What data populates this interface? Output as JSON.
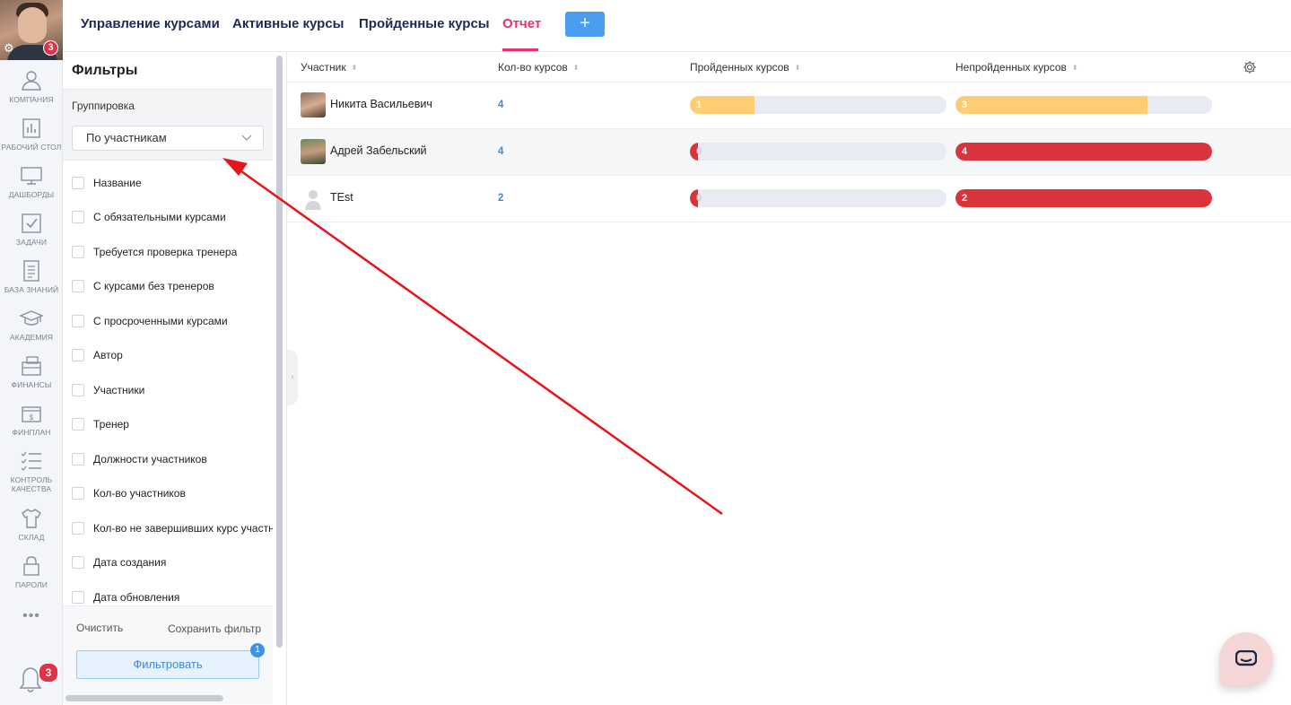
{
  "rail": {
    "avatar_badge": "3",
    "items": [
      {
        "label": "Компания",
        "icon": "company-icon"
      },
      {
        "label": "Рабочий стол",
        "icon": "desktop-chart-icon"
      },
      {
        "label": "Дашборды",
        "icon": "monitor-icon"
      },
      {
        "label": "Задачи",
        "icon": "task-check-icon"
      },
      {
        "label": "База знаний",
        "icon": "document-icon"
      },
      {
        "label": "Академия",
        "icon": "graduation-cap-icon"
      },
      {
        "label": "Финансы",
        "icon": "wallet-icon"
      },
      {
        "label": "Финплан",
        "icon": "budget-icon"
      },
      {
        "label": "Контроль качества",
        "icon": "checklist-icon"
      },
      {
        "label": "Склад",
        "icon": "tshirt-icon"
      },
      {
        "label": "Пароли",
        "icon": "lock-icon"
      }
    ],
    "more": "•••",
    "bell_badge": "3"
  },
  "topbar": {
    "tabs": [
      {
        "label": "Управление курсами"
      },
      {
        "label": "Активные курсы"
      },
      {
        "label": "Пройденные курсы"
      },
      {
        "label": "Отчет"
      }
    ],
    "add_label": "+"
  },
  "filters": {
    "title": "Фильтры",
    "grouping_label": "Группировка",
    "grouping_value": "По участникам",
    "items": [
      "Название",
      "С обязательными курсами",
      "Требуется проверка тренера",
      "С курсами без тренеров",
      "С просроченными курсами",
      "Автор",
      "Участники",
      "Тренер",
      "Должности участников",
      "Кол-во участников",
      "Кол-во не завершивших курс участников",
      "Дата создания",
      "Дата обновления"
    ],
    "clear_label": "Очистить",
    "save_label": "Сохранить фильтр",
    "apply_label": "Фильтровать",
    "apply_badge": "1"
  },
  "table": {
    "headers": {
      "participant": "Участник",
      "count": "Кол-во курсов",
      "passed": "Пройденных курсов",
      "not_passed": "Непройденных курсов"
    },
    "rows": [
      {
        "name": "Никита Васильевич",
        "count": "4",
        "passed": 1,
        "not_passed": 3
      },
      {
        "name": "Адрей Забельский",
        "count": "4",
        "passed": 0,
        "not_passed": 4
      },
      {
        "name": "TEst",
        "count": "2",
        "passed": 0,
        "not_passed": 2
      }
    ]
  },
  "colors": {
    "accent": "#e6336a",
    "primary": "#4a9ef0",
    "bar_yellow": "#fdcd73",
    "bar_red": "#d9343b",
    "bar_track": "#e9ebf2",
    "annotation_arrow": "#e8141c"
  }
}
